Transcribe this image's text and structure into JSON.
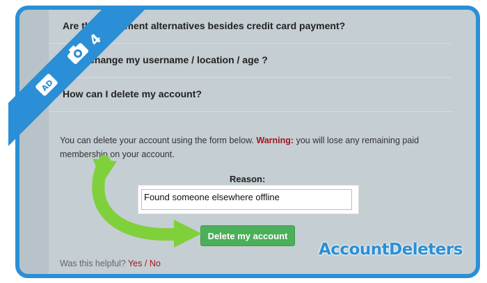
{
  "faq": {
    "questions": [
      {
        "label": "Are there payment alternatives besides credit card payment?"
      },
      {
        "label": "Can I change my username / location / age ?"
      },
      {
        "label": "How can I delete my account?"
      }
    ],
    "answer": {
      "text_before": "You can delete your account using the form below.",
      "warning_label": "Warning:",
      "text_after": "you will lose any remaining paid membership on your account."
    }
  },
  "form": {
    "reason_label": "Reason:",
    "reason_value": "Found someone elsewhere offline",
    "delete_button": "Delete my account"
  },
  "feedback": {
    "prompt": "Was this helpful?",
    "yes": "Yes",
    "separator": "/",
    "no": "No"
  },
  "overlay": {
    "step_number": "4",
    "brand": "AccountDeleters",
    "accent_color": "#2a8fd6",
    "arrow_color": "#7fd03a"
  }
}
